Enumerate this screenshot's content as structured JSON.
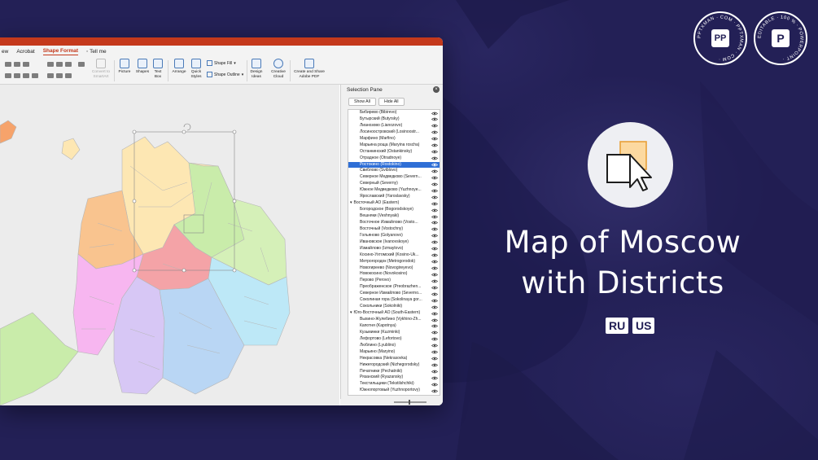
{
  "menubar": {
    "items": [
      "ew",
      "Acrobat",
      "Shape Format",
      "Tell me"
    ],
    "active": "Shape Format"
  },
  "ribbon": {
    "convert": "Convert to SmartArt",
    "picture": "Picture",
    "shapes": "Shapes",
    "textbox": "Text Box",
    "arrange": "Arrange",
    "quick_styles": "Quick Styles",
    "shape_fill": "Shape Fill",
    "shape_outline": "Shape Outline",
    "design_ideas": "Design Ideas",
    "creative_cloud": "Creative Cloud",
    "create_share": "Create and Share Adobe PDF"
  },
  "pane": {
    "title": "Selection Pane",
    "show_all": "Show All",
    "hide_all": "Hide All",
    "rows": [
      {
        "text": "Бибирево (Bibirevo)",
        "type": "sub"
      },
      {
        "text": "Бутырский (Butyrsky)",
        "type": "sub"
      },
      {
        "text": "Лианозово (Lianozovo)",
        "type": "sub"
      },
      {
        "text": "Лосиноостровский (Losinoostr...",
        "type": "sub"
      },
      {
        "text": "Марфино (Marfino)",
        "type": "sub"
      },
      {
        "text": "Марьина роща (Maryina roscha)",
        "type": "sub"
      },
      {
        "text": "Останкинский (Ostankinsky)",
        "type": "sub"
      },
      {
        "text": "Отрадное (Otradnoye)",
        "type": "sub"
      },
      {
        "text": "Ростокино (Rostokino)",
        "type": "sel"
      },
      {
        "text": "Свиблово (Sviblovo)",
        "type": "sub"
      },
      {
        "text": "Северное Медведково (Severn...",
        "type": "sub"
      },
      {
        "text": "Северный (Severny)",
        "type": "sub"
      },
      {
        "text": "Южное Медведково (Yuzhnoye...",
        "type": "sub"
      },
      {
        "text": "Ярославский (Yaroslavsky)",
        "type": "sub"
      },
      {
        "text": "Восточный АО (Eastern)",
        "type": "grp"
      },
      {
        "text": "Богородское (Bogorodskoye)",
        "type": "sub"
      },
      {
        "text": "Вешняки (Veshnyaki)",
        "type": "sub"
      },
      {
        "text": "Восточное Измайлово (Vosto...",
        "type": "sub"
      },
      {
        "text": "Восточный (Vostochny)",
        "type": "sub"
      },
      {
        "text": "Гольяново (Golyanovo)",
        "type": "sub"
      },
      {
        "text": "Ивановское (Ivanovskoye)",
        "type": "sub"
      },
      {
        "text": "Измайлово (Izmaylovo)",
        "type": "sub"
      },
      {
        "text": "Косино-Ухтомский (Kosino-Uk...",
        "type": "sub"
      },
      {
        "text": "Метрогородок (Metrogorodok)",
        "type": "sub"
      },
      {
        "text": "Новогиреево (Novogireyevo)",
        "type": "sub"
      },
      {
        "text": "Новокосино (Novokosino)",
        "type": "sub"
      },
      {
        "text": "Перово (Perovo)",
        "type": "sub"
      },
      {
        "text": "Преображенское (Preobrazhen...",
        "type": "sub"
      },
      {
        "text": "Северное Измайлово (Severno...",
        "type": "sub"
      },
      {
        "text": "Соколиная гора (Sokolinaya gor...",
        "type": "sub"
      },
      {
        "text": "Сокольники (Sokolniki)",
        "type": "sub"
      },
      {
        "text": "Юго-Восточный АО (South-Eastern)",
        "type": "grp"
      },
      {
        "text": "Выхино-Жулебино (Vykhino-Zh...",
        "type": "sub"
      },
      {
        "text": "Капотня (Kapotnya)",
        "type": "sub"
      },
      {
        "text": "Кузьминки (Kuzminki)",
        "type": "sub"
      },
      {
        "text": "Лефортово (Lefortovo)",
        "type": "sub"
      },
      {
        "text": "Люблино (Lyublino)",
        "type": "sub"
      },
      {
        "text": "Марьино (Maryino)",
        "type": "sub"
      },
      {
        "text": "Некрасовка (Nekrasovka)",
        "type": "sub"
      },
      {
        "text": "Нижегородский (Nizhegorodsky)",
        "type": "sub"
      },
      {
        "text": "Печатники (Pechatniki)",
        "type": "sub"
      },
      {
        "text": "Рязанский (Ryazansky)",
        "type": "sub"
      },
      {
        "text": "Текстильщики (Tekstilshchiki)",
        "type": "sub"
      },
      {
        "text": "Южнопортовый (Yuzhnoportovy)",
        "type": "sub"
      }
    ]
  },
  "hero": {
    "title_line1": "Map of Moscow",
    "title_line2": "with Districts",
    "lang1": "RU",
    "lang2": "US"
  },
  "badges": {
    "left_ring": "PPTXMAN · COM · PPTXMAN · COM ·",
    "left_center": "PP",
    "right_ring": "EDITABLE · 100 % · POWERPOINT ·",
    "right_center": "P"
  },
  "colors": {
    "background": "#232056",
    "ppt_accent": "#c4391c",
    "selection": "#2f6fd6",
    "north": "#fde7b3",
    "northwest": "#f9c48f",
    "west": "#f7b6f0",
    "southwest": "#d7c7f5",
    "south": "#b9d6f4",
    "southeast": "#bde8f7",
    "east": "#d5f0b8",
    "northeast": "#c9ecaa",
    "central": "#f4a3a7",
    "zelenograd": "#f6a36b"
  }
}
